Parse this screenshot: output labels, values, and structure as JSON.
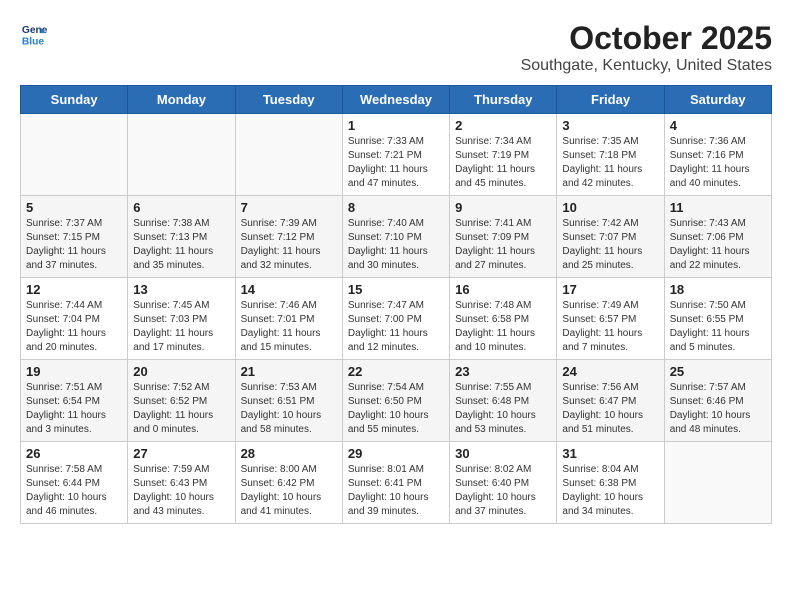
{
  "header": {
    "logo_line1": "General",
    "logo_line2": "Blue",
    "month": "October 2025",
    "location": "Southgate, Kentucky, United States"
  },
  "weekdays": [
    "Sunday",
    "Monday",
    "Tuesday",
    "Wednesday",
    "Thursday",
    "Friday",
    "Saturday"
  ],
  "weeks": [
    [
      {
        "day": "",
        "info": ""
      },
      {
        "day": "",
        "info": ""
      },
      {
        "day": "",
        "info": ""
      },
      {
        "day": "1",
        "info": "Sunrise: 7:33 AM\nSunset: 7:21 PM\nDaylight: 11 hours\nand 47 minutes."
      },
      {
        "day": "2",
        "info": "Sunrise: 7:34 AM\nSunset: 7:19 PM\nDaylight: 11 hours\nand 45 minutes."
      },
      {
        "day": "3",
        "info": "Sunrise: 7:35 AM\nSunset: 7:18 PM\nDaylight: 11 hours\nand 42 minutes."
      },
      {
        "day": "4",
        "info": "Sunrise: 7:36 AM\nSunset: 7:16 PM\nDaylight: 11 hours\nand 40 minutes."
      }
    ],
    [
      {
        "day": "5",
        "info": "Sunrise: 7:37 AM\nSunset: 7:15 PM\nDaylight: 11 hours\nand 37 minutes."
      },
      {
        "day": "6",
        "info": "Sunrise: 7:38 AM\nSunset: 7:13 PM\nDaylight: 11 hours\nand 35 minutes."
      },
      {
        "day": "7",
        "info": "Sunrise: 7:39 AM\nSunset: 7:12 PM\nDaylight: 11 hours\nand 32 minutes."
      },
      {
        "day": "8",
        "info": "Sunrise: 7:40 AM\nSunset: 7:10 PM\nDaylight: 11 hours\nand 30 minutes."
      },
      {
        "day": "9",
        "info": "Sunrise: 7:41 AM\nSunset: 7:09 PM\nDaylight: 11 hours\nand 27 minutes."
      },
      {
        "day": "10",
        "info": "Sunrise: 7:42 AM\nSunset: 7:07 PM\nDaylight: 11 hours\nand 25 minutes."
      },
      {
        "day": "11",
        "info": "Sunrise: 7:43 AM\nSunset: 7:06 PM\nDaylight: 11 hours\nand 22 minutes."
      }
    ],
    [
      {
        "day": "12",
        "info": "Sunrise: 7:44 AM\nSunset: 7:04 PM\nDaylight: 11 hours\nand 20 minutes."
      },
      {
        "day": "13",
        "info": "Sunrise: 7:45 AM\nSunset: 7:03 PM\nDaylight: 11 hours\nand 17 minutes."
      },
      {
        "day": "14",
        "info": "Sunrise: 7:46 AM\nSunset: 7:01 PM\nDaylight: 11 hours\nand 15 minutes."
      },
      {
        "day": "15",
        "info": "Sunrise: 7:47 AM\nSunset: 7:00 PM\nDaylight: 11 hours\nand 12 minutes."
      },
      {
        "day": "16",
        "info": "Sunrise: 7:48 AM\nSunset: 6:58 PM\nDaylight: 11 hours\nand 10 minutes."
      },
      {
        "day": "17",
        "info": "Sunrise: 7:49 AM\nSunset: 6:57 PM\nDaylight: 11 hours\nand 7 minutes."
      },
      {
        "day": "18",
        "info": "Sunrise: 7:50 AM\nSunset: 6:55 PM\nDaylight: 11 hours\nand 5 minutes."
      }
    ],
    [
      {
        "day": "19",
        "info": "Sunrise: 7:51 AM\nSunset: 6:54 PM\nDaylight: 11 hours\nand 3 minutes."
      },
      {
        "day": "20",
        "info": "Sunrise: 7:52 AM\nSunset: 6:52 PM\nDaylight: 11 hours\nand 0 minutes."
      },
      {
        "day": "21",
        "info": "Sunrise: 7:53 AM\nSunset: 6:51 PM\nDaylight: 10 hours\nand 58 minutes."
      },
      {
        "day": "22",
        "info": "Sunrise: 7:54 AM\nSunset: 6:50 PM\nDaylight: 10 hours\nand 55 minutes."
      },
      {
        "day": "23",
        "info": "Sunrise: 7:55 AM\nSunset: 6:48 PM\nDaylight: 10 hours\nand 53 minutes."
      },
      {
        "day": "24",
        "info": "Sunrise: 7:56 AM\nSunset: 6:47 PM\nDaylight: 10 hours\nand 51 minutes."
      },
      {
        "day": "25",
        "info": "Sunrise: 7:57 AM\nSunset: 6:46 PM\nDaylight: 10 hours\nand 48 minutes."
      }
    ],
    [
      {
        "day": "26",
        "info": "Sunrise: 7:58 AM\nSunset: 6:44 PM\nDaylight: 10 hours\nand 46 minutes."
      },
      {
        "day": "27",
        "info": "Sunrise: 7:59 AM\nSunset: 6:43 PM\nDaylight: 10 hours\nand 43 minutes."
      },
      {
        "day": "28",
        "info": "Sunrise: 8:00 AM\nSunset: 6:42 PM\nDaylight: 10 hours\nand 41 minutes."
      },
      {
        "day": "29",
        "info": "Sunrise: 8:01 AM\nSunset: 6:41 PM\nDaylight: 10 hours\nand 39 minutes."
      },
      {
        "day": "30",
        "info": "Sunrise: 8:02 AM\nSunset: 6:40 PM\nDaylight: 10 hours\nand 37 minutes."
      },
      {
        "day": "31",
        "info": "Sunrise: 8:04 AM\nSunset: 6:38 PM\nDaylight: 10 hours\nand 34 minutes."
      },
      {
        "day": "",
        "info": ""
      }
    ]
  ]
}
